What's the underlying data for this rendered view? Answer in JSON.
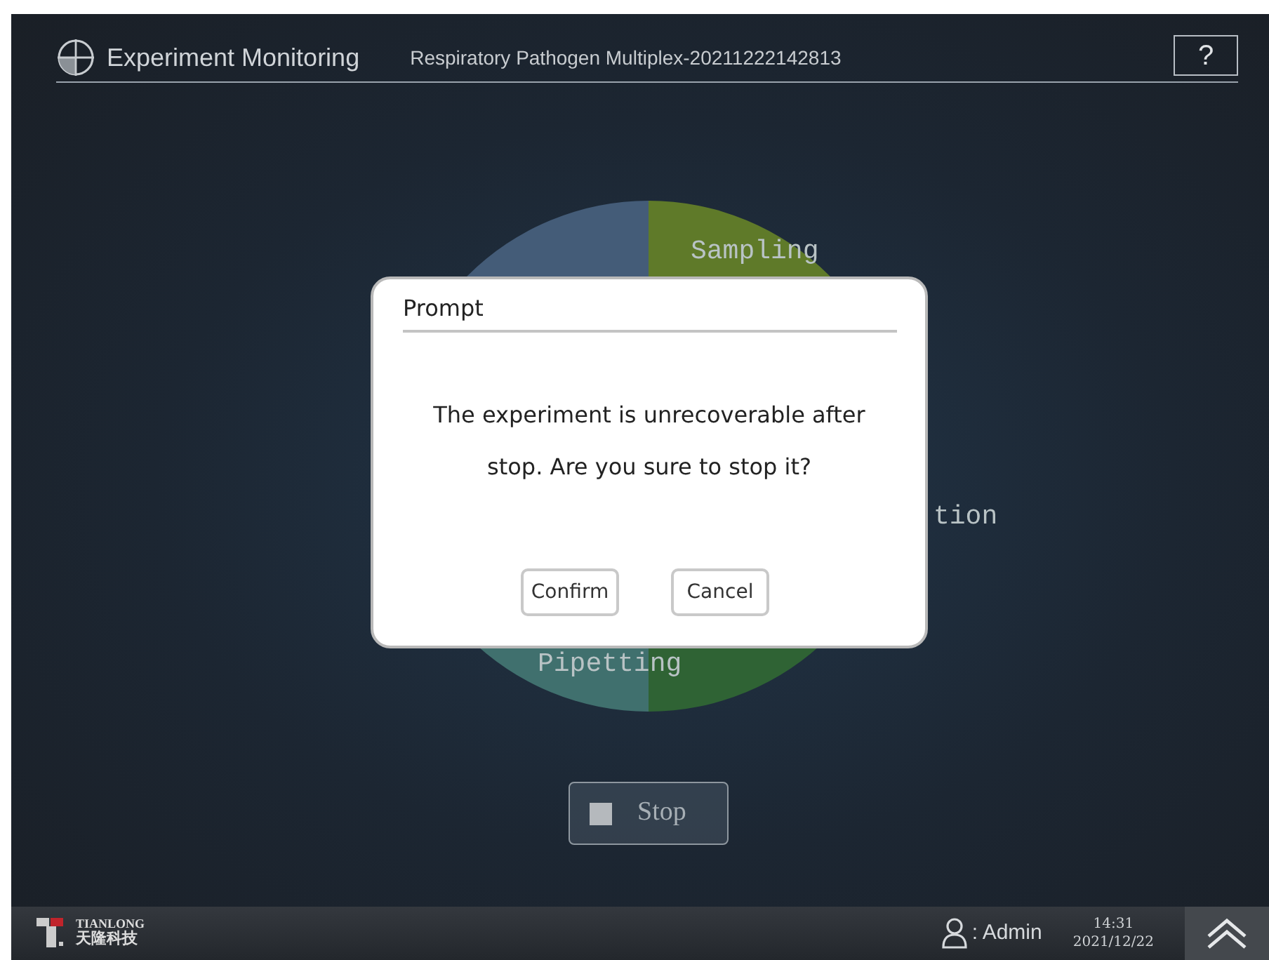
{
  "header": {
    "title": "Experiment Monitoring",
    "experiment": "Respiratory Pathogen Multiplex-20211222142813",
    "help": "?"
  },
  "pie": {
    "segments": [
      {
        "color": "#445c78"
      },
      {
        "color": "#5f7a29",
        "label": "Sampling"
      },
      {
        "color": "#2f6334",
        "label": "tion"
      },
      {
        "color": "#40706e",
        "label": "Pipetting"
      }
    ]
  },
  "stop_button": {
    "label": "Stop"
  },
  "dialog": {
    "title": "Prompt",
    "message": "The experiment is unrecoverable after stop. Are you sure to stop it?",
    "buttons": [
      "Confirm",
      "Cancel"
    ]
  },
  "footer": {
    "logo_name": "TIANLONG",
    "logo_cn": "天隆科技",
    "user": ": Admin",
    "time": "14:31",
    "date": "2021/12/22"
  }
}
